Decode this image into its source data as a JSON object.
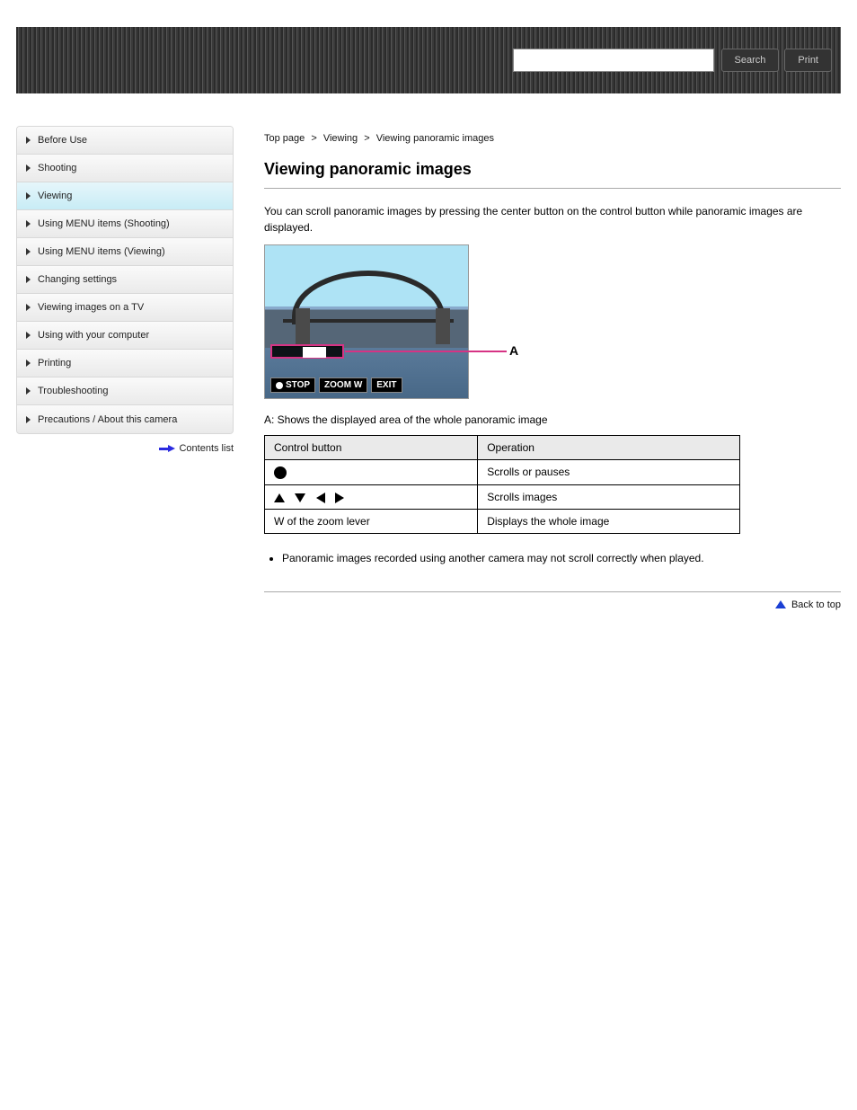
{
  "header": {
    "search_placeholder": "",
    "button_search": "Search",
    "button_print": "Print"
  },
  "sidebar": {
    "items": [
      {
        "label": "Before Use"
      },
      {
        "label": "Shooting"
      },
      {
        "label": "Viewing"
      },
      {
        "label": "Using MENU items (Shooting)"
      },
      {
        "label": "Using MENU items (Viewing)"
      },
      {
        "label": "Changing settings"
      },
      {
        "label": "Viewing images on a TV"
      },
      {
        "label": "Using with your computer"
      },
      {
        "label": "Printing"
      },
      {
        "label": "Troubleshooting"
      },
      {
        "label": "Precautions / About this camera"
      }
    ],
    "active_index": 2,
    "print_link": "Contents list"
  },
  "breadcrumb": {
    "items": [
      "Top page",
      "Viewing",
      "Viewing panoramic images"
    ],
    "separator": ">"
  },
  "page": {
    "title": "Viewing panoramic images",
    "intro": "You can scroll panoramic images by pressing the center button on the control button while panoramic images are displayed.",
    "marker": "A",
    "screen_buttons": {
      "stop": "STOP",
      "zoom": "ZOOM W",
      "exit": "EXIT"
    },
    "caption_a": "A: Shows the displayed area of the whole panoramic image",
    "table": {
      "headers": [
        "Control button",
        "Operation"
      ],
      "rows": [
        {
          "key_symbol": "circle",
          "desc": "Scrolls or pauses"
        },
        {
          "key_symbol": "arrows",
          "desc": "Scrolls images"
        },
        {
          "key_symbol": "zoomw",
          "key_text": "W of the zoom lever",
          "desc": "Displays the whole image"
        }
      ]
    },
    "note": "Panoramic images recorded using another camera may not scroll correctly when played."
  },
  "footer": {
    "back_to_top": "Back to top"
  }
}
